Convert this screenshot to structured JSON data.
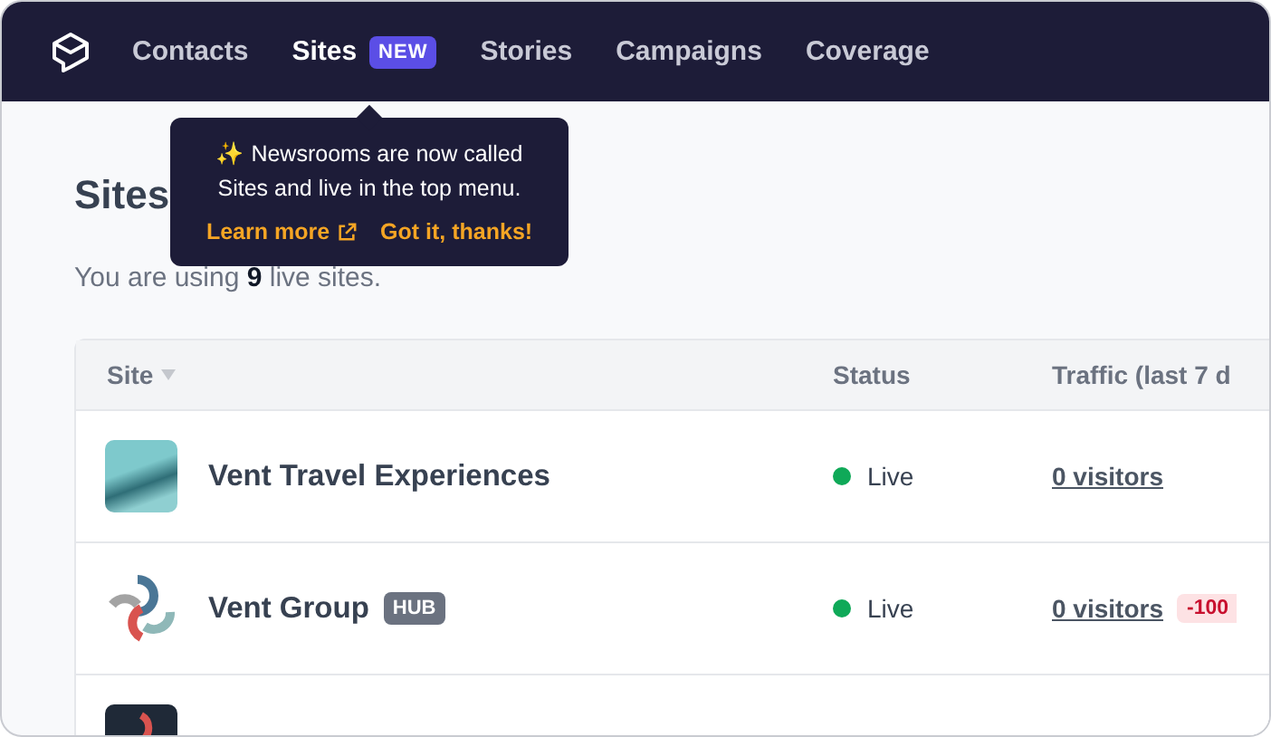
{
  "nav": {
    "items": [
      {
        "label": "Contacts",
        "selected": false
      },
      {
        "label": "Sites",
        "selected": true,
        "badge": "NEW"
      },
      {
        "label": "Stories",
        "selected": false
      },
      {
        "label": "Campaigns",
        "selected": false
      },
      {
        "label": "Coverage",
        "selected": false
      }
    ]
  },
  "tooltip": {
    "icon": "✨",
    "text": "Newsrooms are now called Sites and live in the top menu.",
    "link": "Learn more",
    "dismiss": "Got it, thanks!"
  },
  "page": {
    "title": "Sites",
    "subtitle": "You are using **9** live sites."
  },
  "table": {
    "columns": [
      "Site",
      "Status",
      "Traffic (last 7 d"
    ],
    "rows": [
      {
        "kind": "photo",
        "name": "Vent Travel Experiences",
        "status": "Live",
        "color": "#0fa958",
        "traffic": "0 visitors"
      },
      {
        "kind": "logo",
        "name": "Vent Group",
        "tag": "HUB",
        "status": "Live",
        "color": "#0fa958",
        "traffic": "0 visitors",
        "change": "-100"
      },
      {
        "kind": "dark-logo"
      }
    ]
  }
}
